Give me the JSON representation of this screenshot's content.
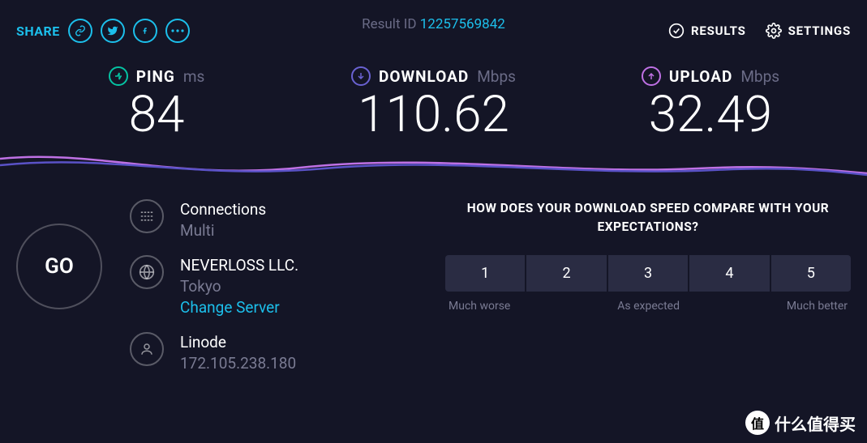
{
  "topbar": {
    "share_label": "SHARE",
    "result_id_label": "Result ID",
    "result_id": "12257569842",
    "results_label": "RESULTS",
    "settings_label": "SETTINGS"
  },
  "metrics": {
    "ping": {
      "label": "PING",
      "unit": "ms",
      "value": "84"
    },
    "download": {
      "label": "DOWNLOAD",
      "unit": "Mbps",
      "value": "110.62"
    },
    "upload": {
      "label": "UPLOAD",
      "unit": "Mbps",
      "value": "32.49"
    }
  },
  "go_label": "GO",
  "info": {
    "connections": {
      "title": "Connections",
      "sub": "Multi"
    },
    "server": {
      "title": "NEVERLOSS LLC.",
      "sub": "Tokyo",
      "change": "Change Server"
    },
    "isp": {
      "title": "Linode",
      "sub": "172.105.238.180"
    }
  },
  "survey": {
    "question": "HOW DOES YOUR DOWNLOAD SPEED COMPARE WITH YOUR EXPECTATIONS?",
    "options": [
      "1",
      "2",
      "3",
      "4",
      "5"
    ],
    "label_low": "Much worse",
    "label_mid": "As expected",
    "label_high": "Much better"
  },
  "watermark": {
    "badge": "值",
    "text": "什么值得买"
  }
}
